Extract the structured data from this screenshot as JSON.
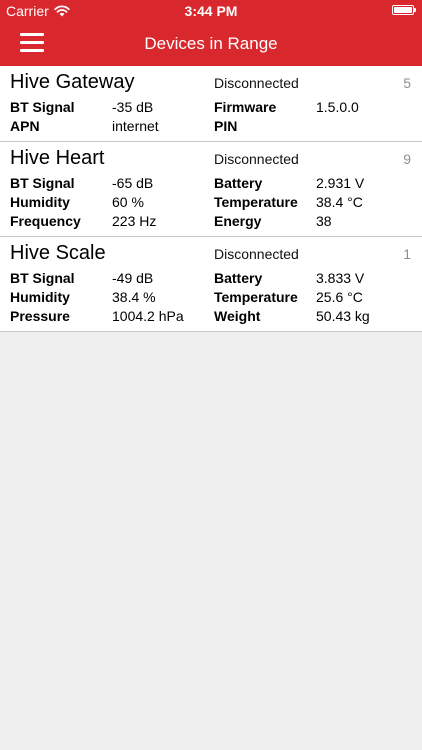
{
  "status_bar": {
    "carrier": "Carrier",
    "time": "3:44 PM",
    "wifi_icon": "wifi-icon",
    "battery_level": 1.0
  },
  "nav": {
    "title": "Devices in Range",
    "menu_icon": "hamburger-menu-icon"
  },
  "colors": {
    "brand_red": "#d8282d",
    "background": "#efefef",
    "count_gray": "#8e8e93"
  },
  "devices": [
    {
      "name": "Hive Gateway",
      "status": "Disconnected",
      "count": "5",
      "rows": [
        {
          "label1": "BT Signal",
          "value1": "-35 dB",
          "label2": "Firmware",
          "value2": "1.5.0.0"
        },
        {
          "label1": "APN",
          "value1": "internet",
          "label2": "PIN",
          "value2": ""
        }
      ]
    },
    {
      "name": "Hive Heart",
      "status": "Disconnected",
      "count": "9",
      "rows": [
        {
          "label1": "BT Signal",
          "value1": "-65 dB",
          "label2": "Battery",
          "value2": "2.931 V"
        },
        {
          "label1": "Humidity",
          "value1": "60 %",
          "label2": "Temperature",
          "value2": "38.4 °C"
        },
        {
          "label1": "Frequency",
          "value1": "223 Hz",
          "label2": "Energy",
          "value2": "38"
        }
      ]
    },
    {
      "name": "Hive Scale",
      "status": "Disconnected",
      "count": "1",
      "rows": [
        {
          "label1": "BT Signal",
          "value1": "-49 dB",
          "label2": "Battery",
          "value2": "3.833 V"
        },
        {
          "label1": "Humidity",
          "value1": "38.4 %",
          "label2": "Temperature",
          "value2": "25.6 °C"
        },
        {
          "label1": "Pressure",
          "value1": "1004.2 hPa",
          "label2": "Weight",
          "value2": "50.43 kg"
        }
      ]
    }
  ]
}
